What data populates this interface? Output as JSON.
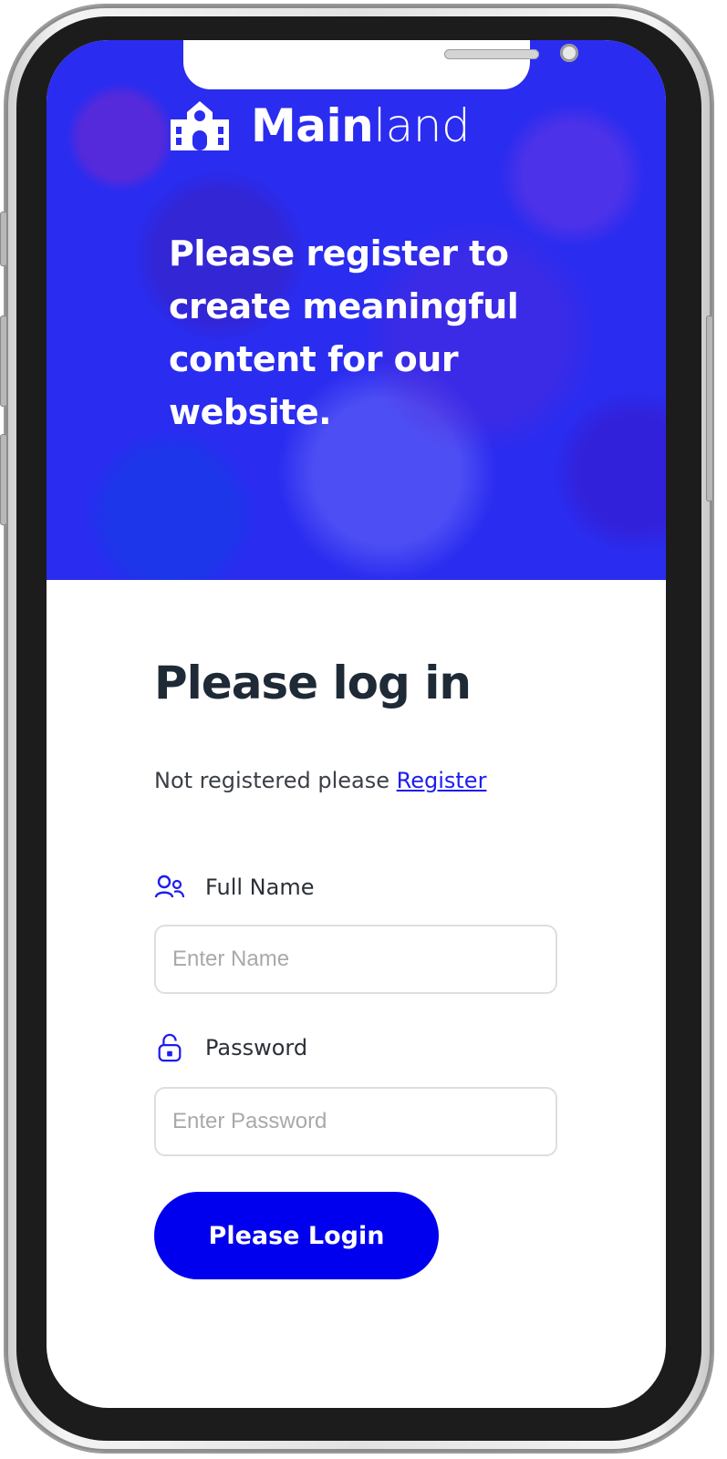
{
  "brand": {
    "name_bold": "Main",
    "name_light": "land"
  },
  "hero": {
    "heading": "Please register to create meaningful content for our website."
  },
  "form": {
    "title": "Please log in",
    "register_prompt": "Not registered please",
    "register_link": "Register",
    "name_label": "Full Name",
    "name_placeholder": "Enter Name",
    "password_label": "Password",
    "password_placeholder": "Enter Password",
    "submit_label": "Please Login"
  },
  "colors": {
    "accent": "#0000EE",
    "hero_overlay": "#2A2CF0",
    "heading_text": "#1F2A37"
  },
  "icons": {
    "brand": "school-building-icon",
    "name_field": "users-icon",
    "password_field": "unlock-icon"
  }
}
